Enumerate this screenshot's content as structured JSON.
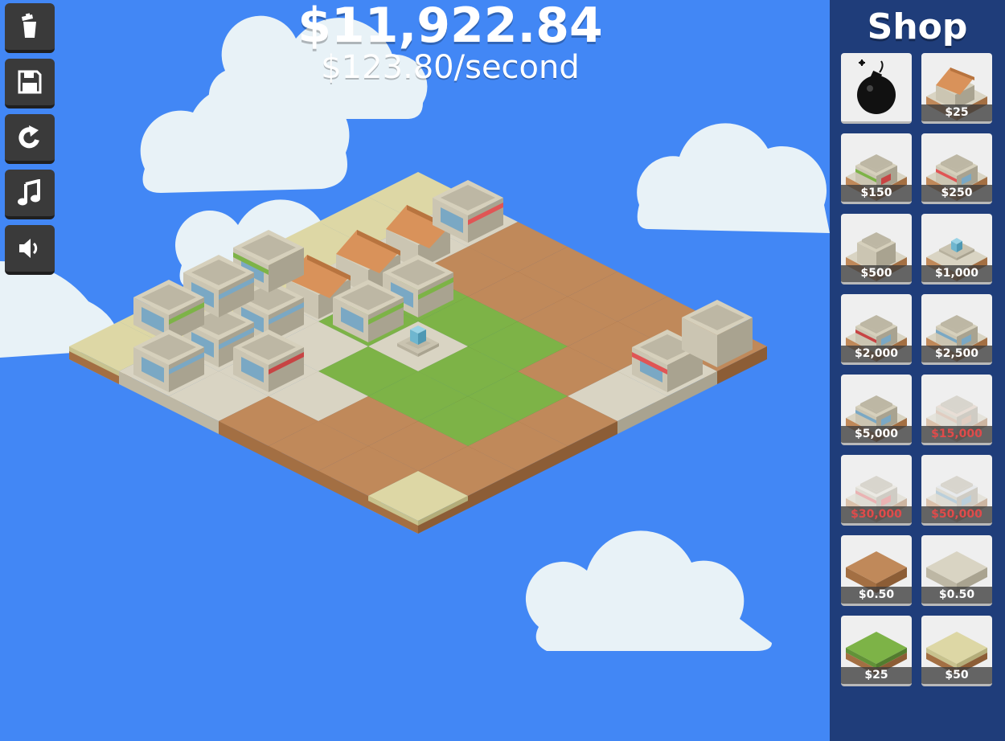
{
  "toolbar": [
    {
      "name": "trash-button",
      "icon": "trash-icon"
    },
    {
      "name": "save-button",
      "icon": "floppy-disk-icon"
    },
    {
      "name": "redo-button",
      "icon": "rotate-arrow-icon"
    },
    {
      "name": "music-button",
      "icon": "music-note-icon"
    },
    {
      "name": "sound-button",
      "icon": "speaker-icon"
    }
  ],
  "money": {
    "total": "$11,922.84",
    "rate": "$123.80/second"
  },
  "shop": {
    "title": "Shop",
    "items": [
      {
        "name": "bomb",
        "price": "",
        "icon": "bomb-icon",
        "affordable": true
      },
      {
        "name": "house",
        "price": "$25",
        "icon": "house-icon",
        "affordable": true
      },
      {
        "name": "green-awning-shop",
        "price": "$150",
        "icon": "green-shop-icon",
        "affordable": true
      },
      {
        "name": "red-awning-shop",
        "price": "$250",
        "icon": "red-shop-icon",
        "affordable": true
      },
      {
        "name": "plain-building",
        "price": "$500",
        "icon": "plain-building-icon",
        "affordable": true
      },
      {
        "name": "fountain",
        "price": "$1,000",
        "icon": "fountain-icon",
        "affordable": true
      },
      {
        "name": "red-store",
        "price": "$2,000",
        "icon": "red-store-icon",
        "affordable": true
      },
      {
        "name": "blue-store",
        "price": "$2,500",
        "icon": "blue-store-icon",
        "affordable": true
      },
      {
        "name": "two-story-building",
        "price": "$5,000",
        "icon": "two-story-icon",
        "affordable": true
      },
      {
        "name": "apartment",
        "price": "$15,000",
        "icon": "apartment-icon",
        "affordable": false
      },
      {
        "name": "diner",
        "price": "$30,000",
        "icon": "diner-icon",
        "affordable": false
      },
      {
        "name": "office",
        "price": "$50,000",
        "icon": "office-icon",
        "affordable": false
      },
      {
        "name": "dirt-tile",
        "price": "$0.50",
        "icon": "dirt-tile-icon",
        "affordable": true
      },
      {
        "name": "concrete-tile",
        "price": "$0.50",
        "icon": "concrete-tile-icon",
        "affordable": true
      },
      {
        "name": "grass-tile",
        "price": "$25",
        "icon": "grass-tile-icon",
        "affordable": true
      },
      {
        "name": "sand-tile",
        "price": "$50",
        "icon": "sand-tile-icon",
        "affordable": true
      }
    ]
  },
  "colors": {
    "sky": "#4287f5",
    "shop_panel": "#1f3d7a",
    "dirt": "#c0895a",
    "grass": "#7db347",
    "sand": "#ddd7a5",
    "concrete": "#d9d4c3",
    "locked_price": "#e04b4b"
  }
}
